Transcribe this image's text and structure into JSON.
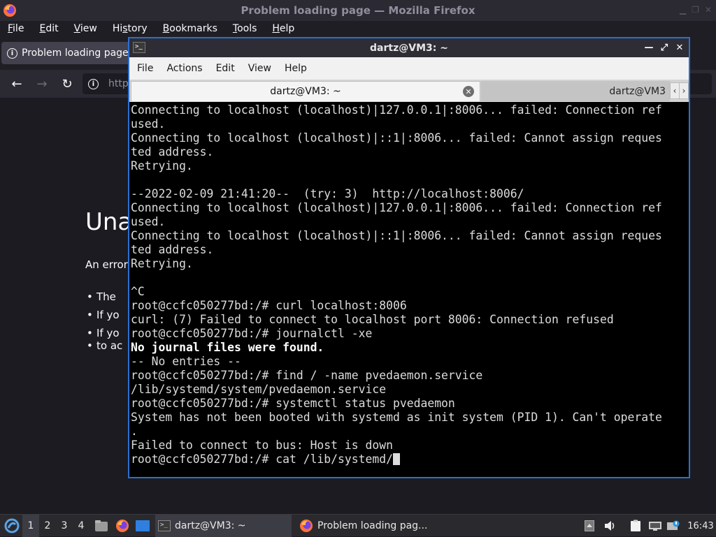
{
  "firefox": {
    "window_title": "Problem loading page — Mozilla Firefox",
    "menu": [
      "File",
      "Edit",
      "View",
      "History",
      "Bookmarks",
      "Tools",
      "Help"
    ],
    "menu_mnemonics": [
      "F",
      "E",
      "V",
      "s",
      "B",
      "T",
      "H"
    ],
    "tab_title": "Problem loading page",
    "url_partial": "http",
    "error_title_partial": "Una",
    "error_text_partial": "An error",
    "error_bullets_partial": [
      "The",
      "If yo",
      "If yo",
      "to ac"
    ]
  },
  "terminal": {
    "window_title": "dartz@VM3: ~",
    "menu": [
      "File",
      "Actions",
      "Edit",
      "View",
      "Help"
    ],
    "tabs": [
      "dartz@VM3: ~",
      "dartz@VM3"
    ],
    "lines": [
      {
        "text": "Connecting to localhost (localhost)|127.0.0.1|:8006... failed: Connection ref",
        "bold": false
      },
      {
        "text": "used.",
        "bold": false
      },
      {
        "text": "Connecting to localhost (localhost)|::1|:8006... failed: Cannot assign reques",
        "bold": false
      },
      {
        "text": "ted address.",
        "bold": false
      },
      {
        "text": "Retrying.",
        "bold": false
      },
      {
        "text": "",
        "bold": false
      },
      {
        "text": "--2022-02-09 21:41:20--  (try: 3)  http://localhost:8006/",
        "bold": false
      },
      {
        "text": "Connecting to localhost (localhost)|127.0.0.1|:8006... failed: Connection ref",
        "bold": false
      },
      {
        "text": "used.",
        "bold": false
      },
      {
        "text": "Connecting to localhost (localhost)|::1|:8006... failed: Cannot assign reques",
        "bold": false
      },
      {
        "text": "ted address.",
        "bold": false
      },
      {
        "text": "Retrying.",
        "bold": false
      },
      {
        "text": "",
        "bold": false
      },
      {
        "text": "^C",
        "bold": false
      },
      {
        "text": "root@ccfc050277bd:/# curl localhost:8006",
        "bold": false
      },
      {
        "text": "curl: (7) Failed to connect to localhost port 8006: Connection refused",
        "bold": false
      },
      {
        "text": "root@ccfc050277bd:/# journalctl -xe",
        "bold": false
      },
      {
        "text": "No journal files were found.",
        "bold": true
      },
      {
        "text": "-- No entries --",
        "bold": false
      },
      {
        "text": "root@ccfc050277bd:/# find / -name pvedaemon.service",
        "bold": false
      },
      {
        "text": "/lib/systemd/system/pvedaemon.service",
        "bold": false
      },
      {
        "text": "root@ccfc050277bd:/# systemctl status pvedaemon",
        "bold": false
      },
      {
        "text": "System has not been booted with systemd as init system (PID 1). Can't operate",
        "bold": false
      },
      {
        "text": ".",
        "bold": false
      },
      {
        "text": "Failed to connect to bus: Host is down",
        "bold": false
      }
    ],
    "prompt_line": "root@ccfc050277bd:/# cat /lib/systemd/"
  },
  "taskbar": {
    "workspaces": [
      "1",
      "2",
      "3",
      "4"
    ],
    "active_workspace": "1",
    "tasks": [
      {
        "label": "dartz@VM3: ~",
        "icon": "terminal-icon"
      },
      {
        "label": "Problem loading pag...",
        "icon": "firefox-icon"
      }
    ],
    "clock": "16:43"
  },
  "colors": {
    "accent": "#2c6fcf",
    "terminal_bg": "#000000",
    "firefox_bg": "#1c1b22"
  }
}
